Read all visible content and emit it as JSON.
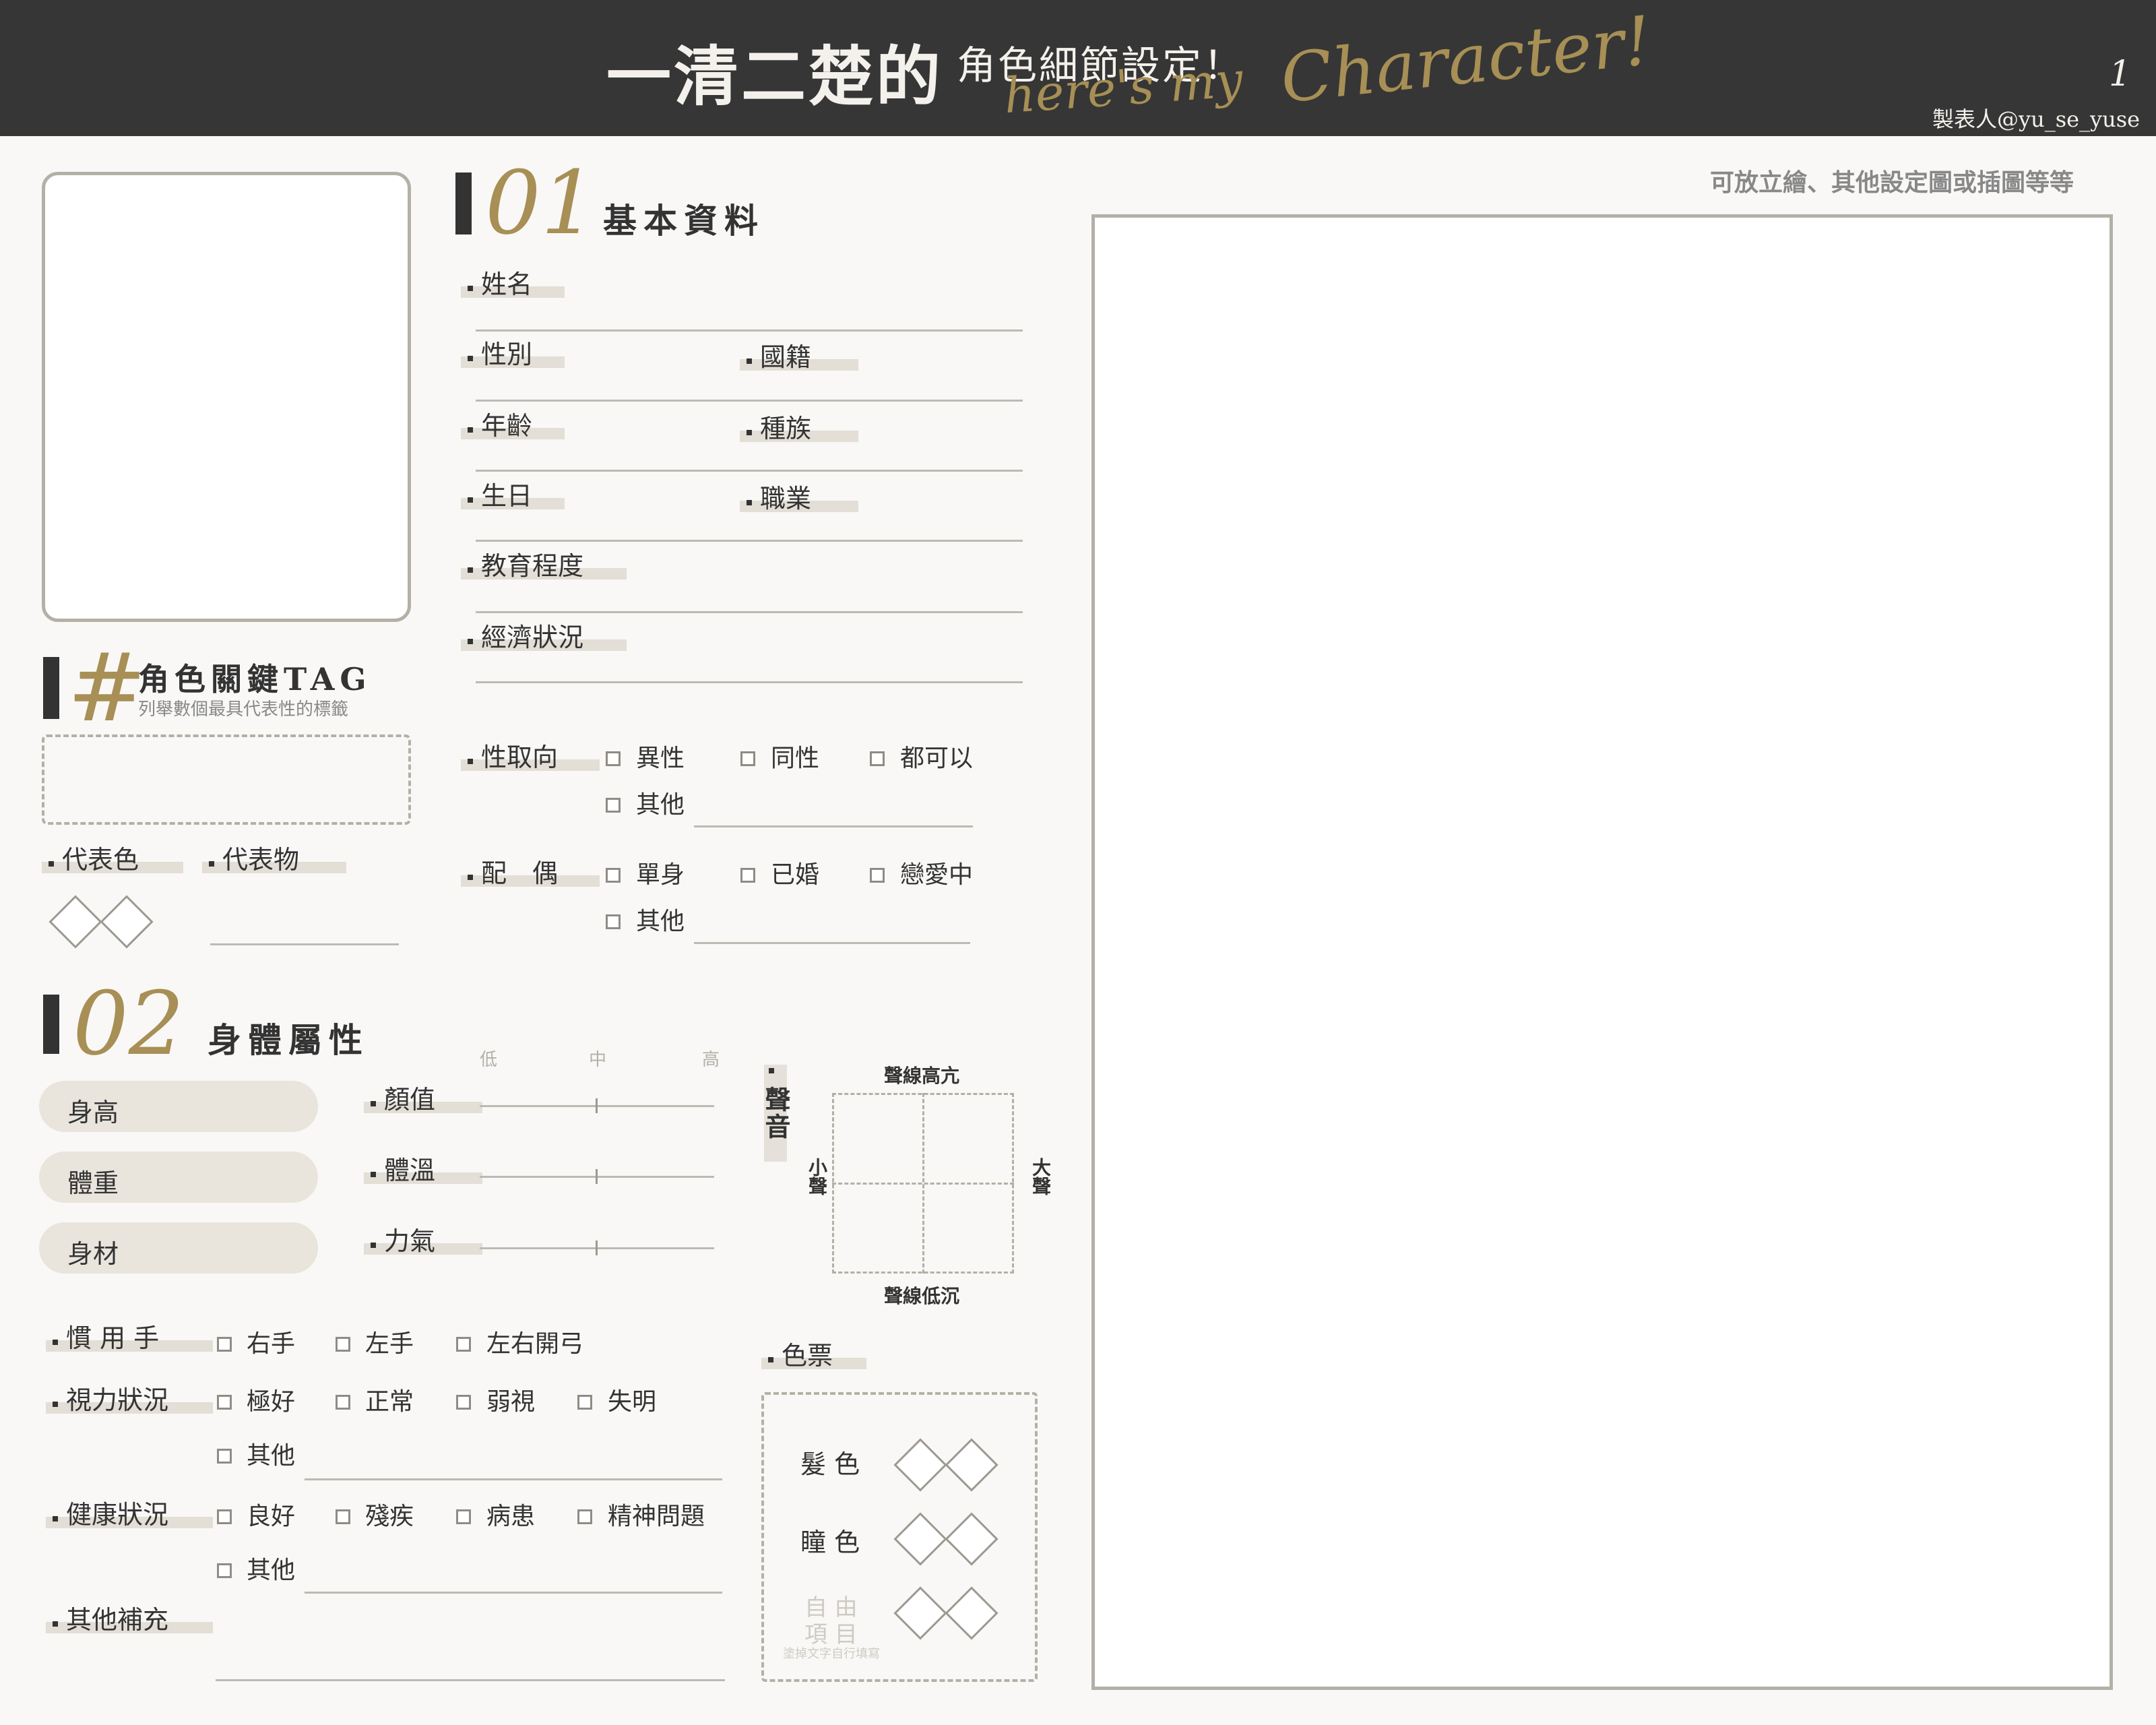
{
  "header": {
    "title_main": "一清二楚的",
    "title_sub": "角色細節設定！",
    "script_line1": "here's my",
    "script_line2": "Character!",
    "page_number": "1",
    "credit": "製表人@yu_se_yuse"
  },
  "portrait_box": {},
  "tag_section": {
    "symbol": "#",
    "title": "角色關鍵TAG",
    "subtitle": "列舉數個最具代表性的標籤"
  },
  "symbols": {
    "label_color": "代表色",
    "label_item": "代表物"
  },
  "basic": {
    "number": "01",
    "title": "基本資料",
    "name": "姓名",
    "gender": "性別",
    "nationality": "國籍",
    "age": "年齡",
    "race": "種族",
    "birthday": "生日",
    "job": "職業",
    "education": "教育程度",
    "economy": "經濟狀況"
  },
  "orientation": {
    "label": "性取向",
    "options": [
      "異性",
      "同性",
      "都可以",
      "其他"
    ]
  },
  "spouse": {
    "label": "配　偶",
    "options": [
      "單身",
      "已婚",
      "戀愛中",
      "其他"
    ]
  },
  "body": {
    "number": "02",
    "title": "身體屬性",
    "pills": [
      "身高",
      "體重",
      "身材"
    ],
    "scale": [
      "低",
      "中",
      "高"
    ],
    "sliders": [
      "顏值",
      "體溫",
      "力氣"
    ]
  },
  "voice": {
    "label": "聲音",
    "top": "聲線高亢",
    "bottom": "聲線低沉",
    "left": "小聲",
    "right": "大聲"
  },
  "handedness": {
    "label": "慣 用 手",
    "options": [
      "右手",
      "左手",
      "左右開弓"
    ]
  },
  "vision": {
    "label": "視力狀況",
    "options": [
      "極好",
      "正常",
      "弱視",
      "失明",
      "其他"
    ]
  },
  "health": {
    "label": "健康狀況",
    "options": [
      "良好",
      "殘疾",
      "病患",
      "精神問題",
      "其他"
    ]
  },
  "other": {
    "label": "其他補充"
  },
  "palette": {
    "label": "色票",
    "hair": "髮 色",
    "eye": "瞳 色",
    "free_1": "自 由",
    "free_2": "項 目",
    "free_note": "塗掉文字自行填寫"
  },
  "right_panel": {
    "note": "可放立繪、其他設定圖或插圖等等"
  },
  "colors": {
    "header_bg": "#363636",
    "gold": "#a78f55",
    "label_highlight": "#e3ded6",
    "frame": "#b3b0a5",
    "page_bg": "#f9f8f6"
  }
}
